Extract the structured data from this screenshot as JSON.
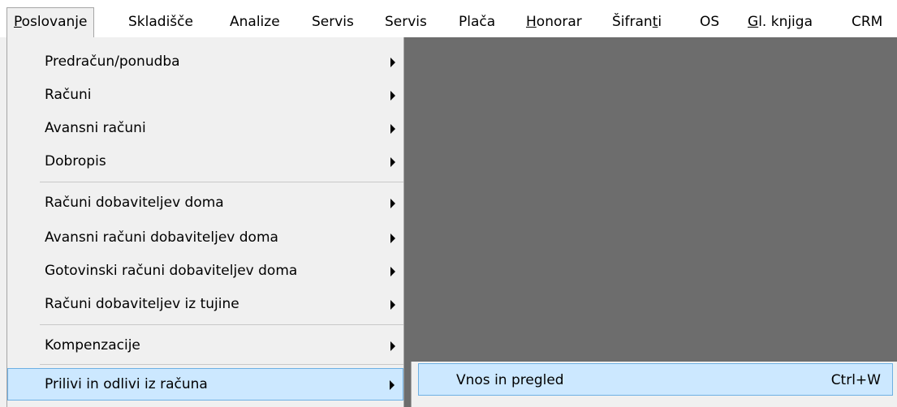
{
  "menubar": {
    "items": [
      {
        "pre": "",
        "u": "P",
        "post": "oslovanje"
      },
      {
        "pre": "Skladišče",
        "u": "",
        "post": ""
      },
      {
        "pre": "Analize",
        "u": "",
        "post": ""
      },
      {
        "pre": "Servis",
        "u": "",
        "post": ""
      },
      {
        "pre": "Servis",
        "u": "",
        "post": ""
      },
      {
        "pre": "Plača",
        "u": "",
        "post": ""
      },
      {
        "pre": "",
        "u": "H",
        "post": "onorar"
      },
      {
        "pre": "Šifran",
        "u": "t",
        "post": "i"
      },
      {
        "pre": "OS",
        "u": "",
        "post": ""
      },
      {
        "pre": "",
        "u": "G",
        "post": "l. knjiga"
      },
      {
        "pre": "CRM",
        "u": "",
        "post": ""
      }
    ]
  },
  "menu": {
    "items": [
      {
        "label": "Predračun/ponudba"
      },
      {
        "label": "Računi"
      },
      {
        "label": "Avansni računi"
      },
      {
        "label": "Dobropis"
      },
      {
        "label": "Računi dobaviteljev doma"
      },
      {
        "label": "Avansni računi dobaviteljev doma"
      },
      {
        "label": "Gotovinski računi dobaviteljev doma"
      },
      {
        "label": "Računi dobaviteljev iz tujine"
      },
      {
        "label": "Kompenzacije"
      },
      {
        "label": "Prilivi in odlivi iz računa"
      }
    ]
  },
  "submenu": {
    "label": "Vnos in pregled",
    "shortcut": "Ctrl+W"
  },
  "colors": {
    "background": "#6d6d6d",
    "menu": "#f0f0f0",
    "highlight": "#cce8ff",
    "highlight_border": "#6eb0e3"
  }
}
